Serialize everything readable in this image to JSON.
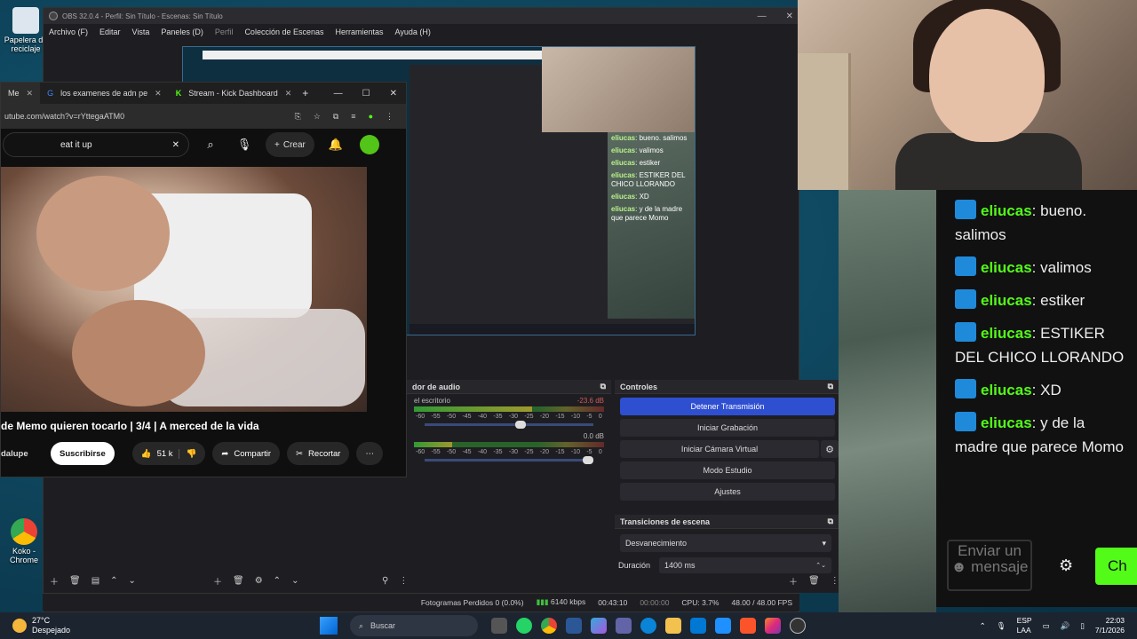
{
  "desktop": {
    "icons": [
      {
        "label": "Papelera de reciclaje"
      },
      {
        "label": "Koko - Chrome"
      }
    ]
  },
  "obs": {
    "title": "OBS 32.0.4 - Perfil: Sin Título - Escenas: Sin Título",
    "menu": [
      "Archivo (F)",
      "Editar",
      "Vista",
      "Paneles (D)",
      "Perfil",
      "Colección de Escenas",
      "Herramientas",
      "Ayuda (H)"
    ],
    "mixer": {
      "title": "dor de audio",
      "tracks": [
        {
          "name": "el escritorio",
          "db": "-23.6 dB",
          "level": 0.62,
          "volume": 0.6
        },
        {
          "name": "",
          "db": "0.0 dB",
          "level": 0.2,
          "volume": 1.0
        }
      ],
      "ticks": [
        "-60",
        "-55",
        "-50",
        "-45",
        "-40",
        "-35",
        "-30",
        "-25",
        "-20",
        "-15",
        "-10",
        "-5",
        "0"
      ]
    },
    "controls": {
      "title": "Controles",
      "stop_stream": "Detener Transmisión",
      "start_recording": "Iniciar Grabación",
      "start_virtual_cam": "Iniciar Cámara Virtual",
      "studio_mode": "Modo Estudio",
      "settings": "Ajustes"
    },
    "transitions": {
      "title": "Transiciones de escena",
      "selected": "Desvanecimiento",
      "duration_label": "Duración",
      "duration_value": "1400 ms"
    },
    "status": {
      "dropped_frames": "Fotogramas Perdidos 0 (0.0%)",
      "bitrate": "6140 kbps",
      "stream_time": "00:43:10",
      "rec_time": "00:00:00",
      "cpu": "CPU: 3.7%",
      "fps": "48.00 / 48.00 FPS"
    },
    "preview_chat": [
      {
        "user": "eliucas",
        "text": "bueno. salimos"
      },
      {
        "user": "eliucas",
        "text": "valimos"
      },
      {
        "user": "eliucas",
        "text": "estiker"
      },
      {
        "user": "eliucas",
        "text": "ESTIKER DEL CHICO LLORANDO"
      },
      {
        "user": "eliucas",
        "text": "XD"
      },
      {
        "user": "eliucas",
        "text": "y de la madre que parece Momo"
      }
    ]
  },
  "browser": {
    "tabs": [
      {
        "label": "Me"
      },
      {
        "label": "los examenes de adn pe"
      },
      {
        "label": "Stream - Kick Dashboard"
      }
    ],
    "url": "utube.com/watch?v=rYttegaATM0",
    "search_value": "eat it up",
    "create_label": "Crear",
    "video_title": "de Memo quieren tocarlo | 3/4 | A merced de la vida",
    "channel": "dalupe",
    "subscribe": "Suscribirse",
    "likes": "51 k",
    "share": "Compartir",
    "clip": "Recortar"
  },
  "chat": {
    "messages": [
      {
        "user": "eliucas",
        "text": "bueno. salimos"
      },
      {
        "user": "eliucas",
        "text": "valimos"
      },
      {
        "user": "eliucas",
        "text": "estiker"
      },
      {
        "user": "eliucas",
        "text": "ESTIKER DEL CHICO LLORANDO"
      },
      {
        "user": "eliucas",
        "text": "XD"
      },
      {
        "user": "eliucas",
        "text": "y de la madre que parece Momo"
      }
    ],
    "input_placeholder": "Enviar un ☻ mensaje",
    "send_label": "Ch"
  },
  "taskbar": {
    "temp": "27°C",
    "weather": "Despejado",
    "search": "Buscar",
    "lang": "ESP",
    "lang2": "LAA",
    "time": "22:03",
    "date": "7/1/2026"
  },
  "colors": {
    "accent": "#2f4fd1",
    "kick_green": "#53fc18"
  }
}
